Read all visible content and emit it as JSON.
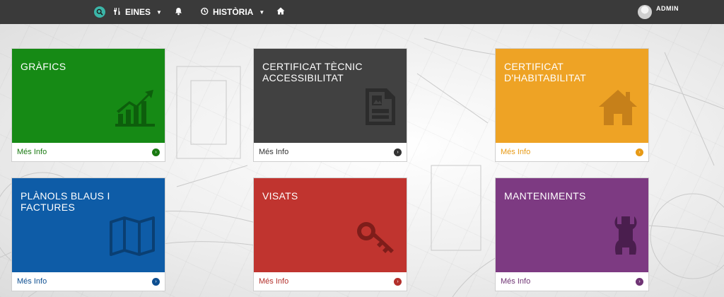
{
  "nav": {
    "tools_label": "EINES",
    "history_label": "HISTÒRIA",
    "user_label": "ADMIN"
  },
  "tiles": [
    {
      "title": "GRÀFICS",
      "link": "Més Info",
      "color": "#168a15",
      "link_color": "#1a7a12",
      "icon": "bar-chart-icon"
    },
    {
      "title": "CERTIFICAT TÈCNIC ACCESSIBILITAT",
      "link": "Més Info",
      "color": "#414141",
      "link_color": "#333333",
      "icon": "document-image-icon"
    },
    {
      "title": "CERTIFICAT D'HABITABILITAT",
      "link": "Més Info",
      "color": "#eea325",
      "link_color": "#e79a16",
      "icon": "house-icon"
    },
    {
      "title": "PLÀNOLS BLAUS I FACTURES",
      "link": "Més Info",
      "color": "#0e5ca7",
      "link_color": "#0e4f91",
      "icon": "map-icon"
    },
    {
      "title": "VISATS",
      "link": "Més Info",
      "color": "#c0342f",
      "link_color": "#b3302b",
      "icon": "key-icon"
    },
    {
      "title": "MANTENIMENTS",
      "link": "Més Info",
      "color": "#7d3a82",
      "link_color": "#6f3474",
      "icon": "wrench-icon"
    }
  ]
}
